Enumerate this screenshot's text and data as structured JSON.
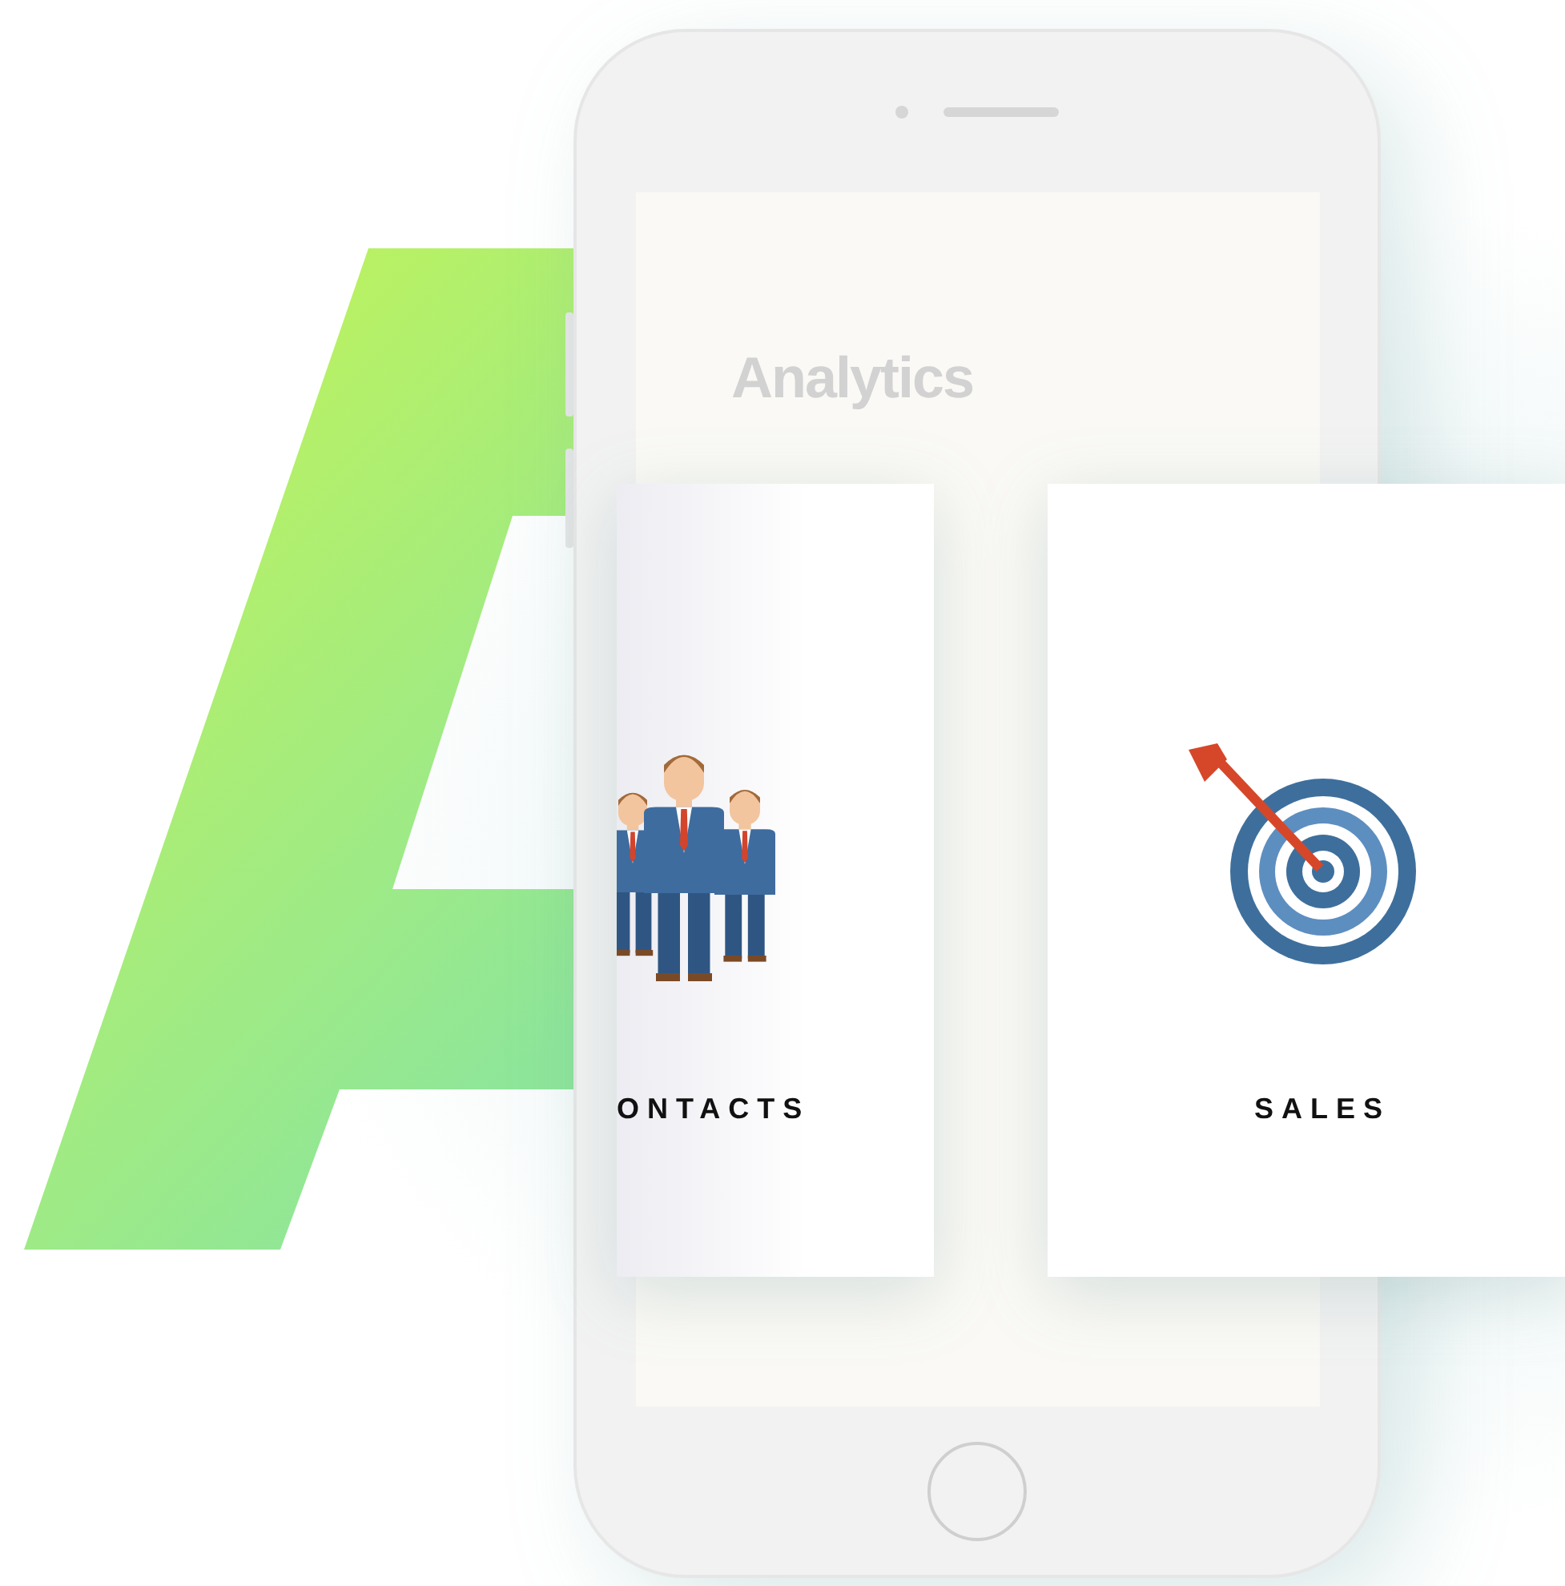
{
  "screen": {
    "title": "Analytics"
  },
  "cards": [
    {
      "kind": "contacts",
      "label": "ONTACTS"
    },
    {
      "kind": "sales",
      "label": "SALES"
    }
  ]
}
